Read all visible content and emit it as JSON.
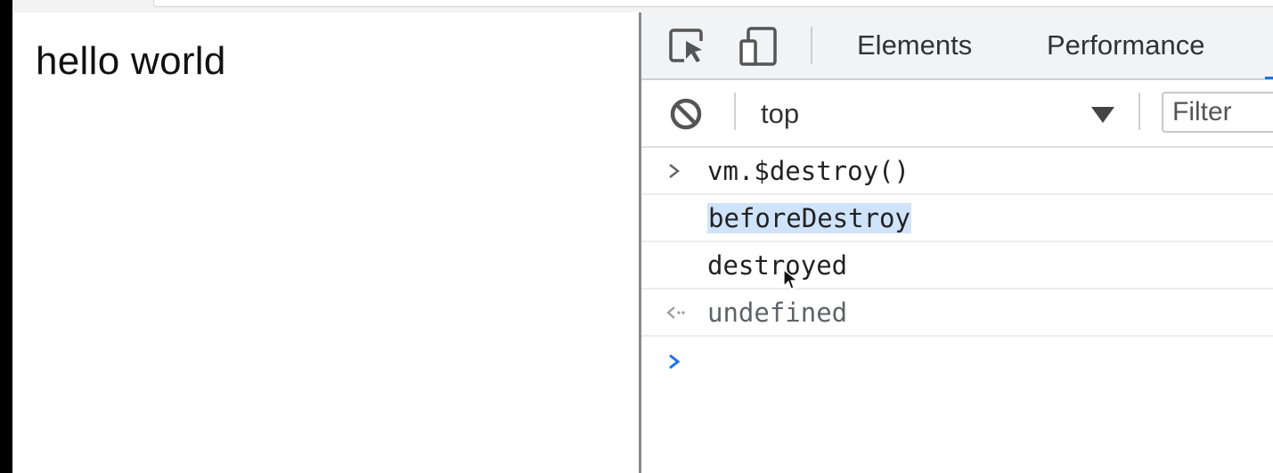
{
  "page": {
    "content_text": "hello world"
  },
  "devtools": {
    "toolbar": {
      "inspect_icon": "element-picker-icon",
      "device_icon": "device-toolbar-icon",
      "tabs": [
        {
          "label": "Elements"
        },
        {
          "label": "Performance"
        }
      ]
    },
    "console_toolbar": {
      "clear_icon": "clear-console-icon",
      "context": "top",
      "filter_placeholder": "Filter"
    },
    "console": {
      "entries": [
        {
          "kind": "input",
          "text": "vm.$destroy()"
        },
        {
          "kind": "log",
          "text": "beforeDestroy",
          "selected": true
        },
        {
          "kind": "log",
          "text": "destroyed"
        },
        {
          "kind": "result",
          "text": "undefined"
        }
      ],
      "prompt_icon": "prompt-chevron-icon"
    }
  },
  "colors": {
    "accent": "#1a73e8",
    "selection": "#cfe3fb"
  }
}
